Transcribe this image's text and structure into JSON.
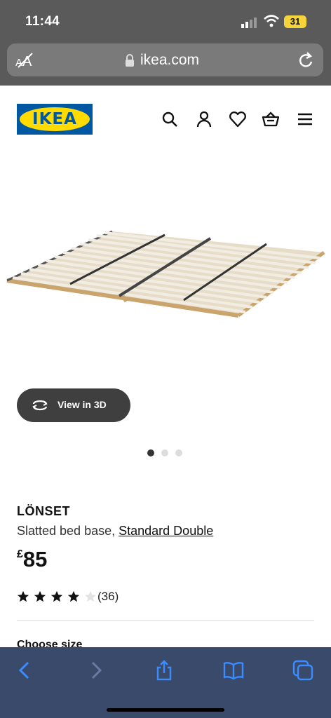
{
  "status_bar": {
    "time": "11:44",
    "battery": "31"
  },
  "browser": {
    "host": "ikea.com",
    "reader_label": "AA"
  },
  "header": {
    "logo_text": "IKEA",
    "icons": [
      "search-icon",
      "user-icon",
      "heart-icon",
      "basket-icon",
      "menu-icon"
    ]
  },
  "gallery": {
    "view_3d_label": "View in 3D",
    "slide_count": 3,
    "active_slide": 1
  },
  "product": {
    "name": "LÖNSET",
    "description": "Slatted bed base,",
    "size_link": "Standard Double",
    "currency": "£",
    "price": "85",
    "rating": 4,
    "rating_max": 5,
    "review_count": "(36)",
    "choose_size_label": "Choose size"
  },
  "colors": {
    "brand_blue": "#0058a3",
    "brand_yellow": "#ffdb00",
    "toolbar_tint": "#3a4a6a",
    "toolbar_icon": "#3b8cff"
  }
}
